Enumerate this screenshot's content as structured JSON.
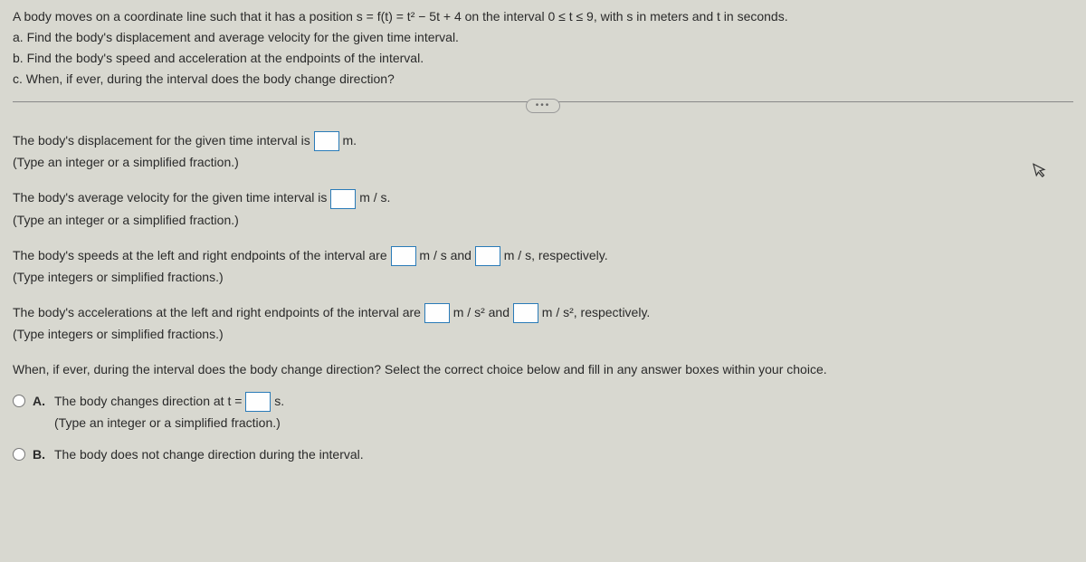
{
  "problem": {
    "intro": "A body moves on a coordinate line such that it has a position s = f(t) = t² − 5t + 4 on the interval 0 ≤ t ≤ 9, with s in meters and t in seconds.",
    "a": "a. Find the body's displacement and average velocity for the given time interval.",
    "b": "b. Find the body's speed and acceleration at the endpoints of the interval.",
    "c": "c. When, if ever, during the interval does the body change direction?"
  },
  "ellipsis": "•••",
  "answers": {
    "displacement": {
      "prefix": "The body's displacement for the given time interval is",
      "unit": " m.",
      "hint": "(Type an integer or a simplified fraction.)"
    },
    "avgVelocity": {
      "prefix": "The body's average velocity for the given time interval is",
      "unit": " m / s.",
      "hint": "(Type an integer or a simplified fraction.)"
    },
    "speeds": {
      "prefix": "The body's speeds at the left and right endpoints of the interval are",
      "mid": " m / s and ",
      "suffix": " m / s, respectively.",
      "hint": "(Type integers or simplified fractions.)"
    },
    "accelerations": {
      "prefix": "The body's accelerations at the left and right endpoints of the interval are",
      "mid": " m / s² and ",
      "suffix": " m / s², respectively.",
      "hint": "(Type integers or simplified fractions.)"
    },
    "direction": {
      "question": "When, if ever, during the interval does the body change direction? Select the correct choice below and fill in any answer boxes within your choice.",
      "optionA": {
        "letter": "A.",
        "prefix": "The body changes direction at t = ",
        "unit": " s.",
        "hint": "(Type an integer or a simplified fraction.)"
      },
      "optionB": {
        "letter": "B.",
        "text": "The body does not change direction during the interval."
      }
    }
  }
}
